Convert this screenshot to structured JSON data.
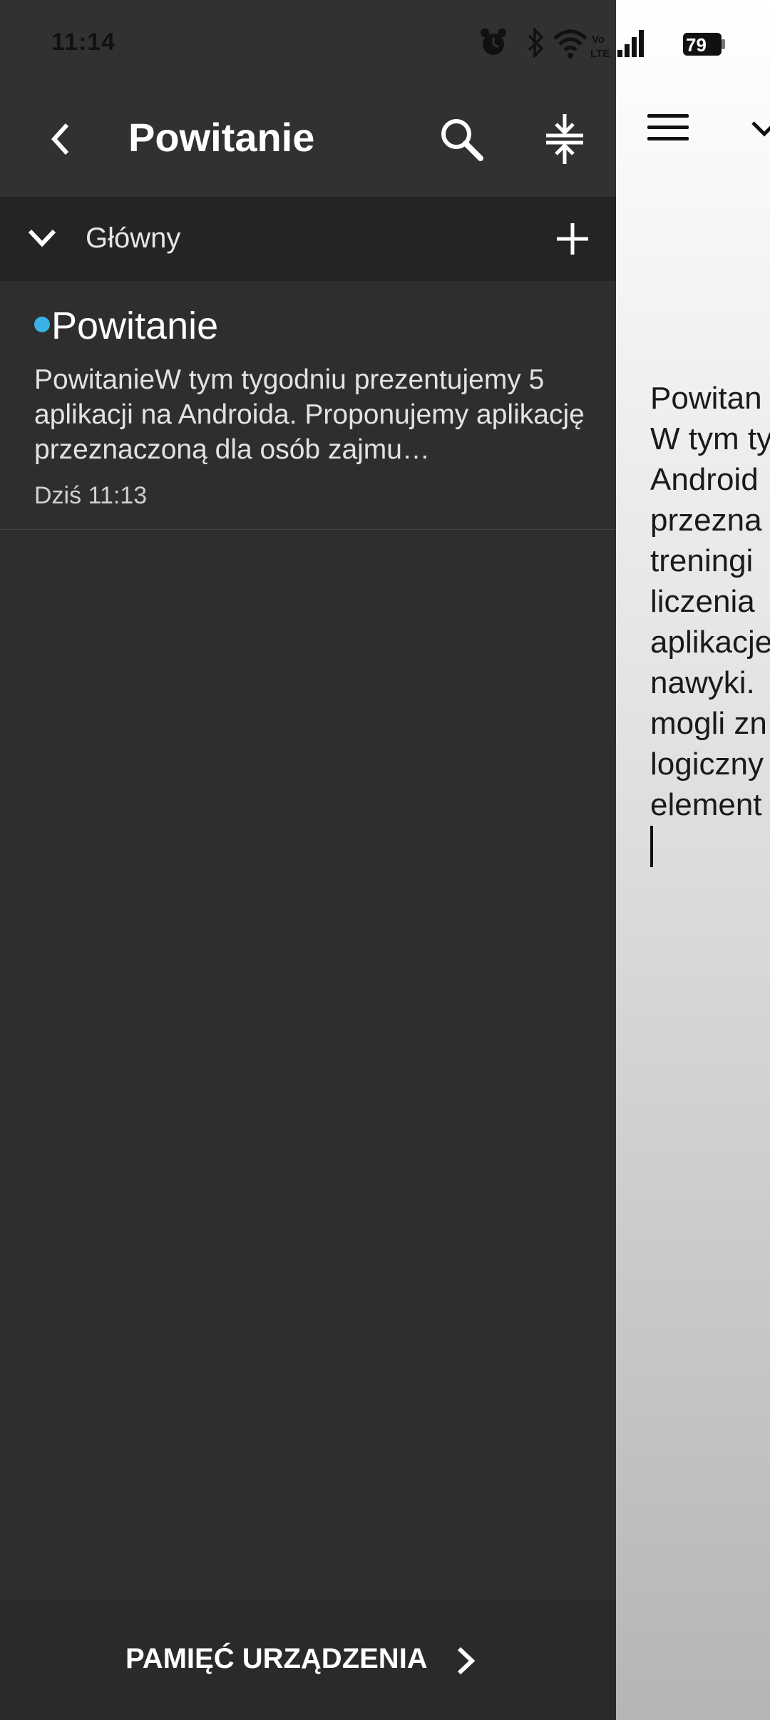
{
  "status_bar": {
    "time": "11:14",
    "battery": "79",
    "icons": [
      "alarm-icon",
      "bluetooth-icon",
      "wifi-icon",
      "volte-icon",
      "signal-icon",
      "battery-icon"
    ]
  },
  "drawer": {
    "title": "Powitanie",
    "section": {
      "label": "Główny"
    },
    "notes": [
      {
        "title": "Powitanie",
        "body": "PowitanieW tym tygodniu prezentujemy 5 aplikacji na Androida. Proponujemy aplikację przeznaczoną dla osób zajmu…",
        "date": "Dziś 11:13",
        "dot_color": "#3ab1e6"
      }
    ],
    "storage_label": "PAMIĘĆ URZĄDZENIA"
  },
  "editor": {
    "lines": [
      "Powitan",
      "W tym ty",
      "Android",
      "przezna",
      "treningi",
      "liczenia",
      "aplikacje",
      "nawyki.",
      "mogli zn",
      "logiczny",
      "element"
    ]
  },
  "colors": {
    "drawer_bg": "#2e2e2e",
    "section_bg": "#242424",
    "accent_dot": "#3ab1e6"
  }
}
